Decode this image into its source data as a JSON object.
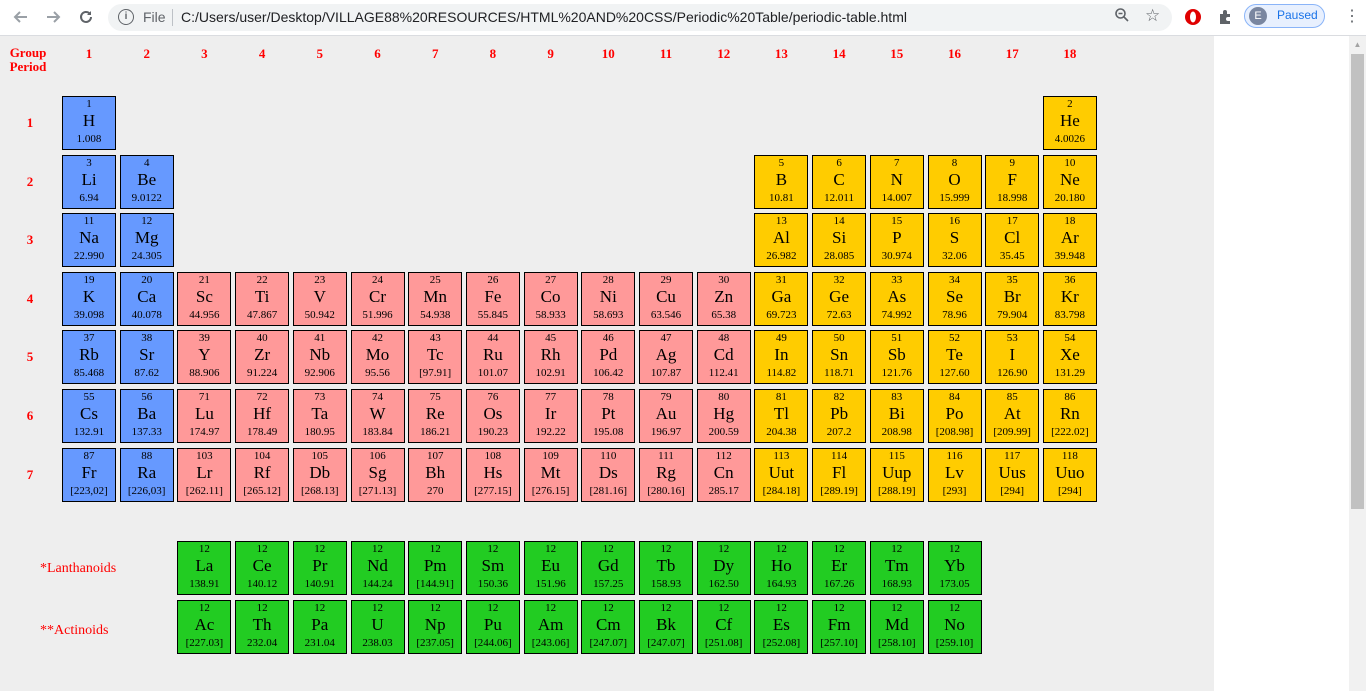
{
  "browser": {
    "back_icon": "arrow-left-icon",
    "forward_icon": "arrow-right-icon",
    "reload_icon": "reload-icon",
    "scheme_label": "File",
    "url": "C:/Users/user/Desktop/VILLAGE88%20RESOURCES/HTML%20AND%20CSS/Periodic%20Table/periodic-table.html",
    "profile_initial": "E",
    "profile_status": "Paused"
  },
  "table": {
    "group_label": "Group",
    "period_label": "Period",
    "groups": [
      "1",
      "2",
      "3",
      "4",
      "5",
      "6",
      "7",
      "8",
      "9",
      "10",
      "11",
      "12",
      "13",
      "14",
      "15",
      "16",
      "17",
      "18"
    ],
    "periods": [
      "1",
      "2",
      "3",
      "4",
      "5",
      "6",
      "7"
    ],
    "lanthanoids_label": "*Lanthanoids",
    "actinoids_label": "**Actinoids",
    "colors": {
      "blue": "#6699ff",
      "red": "#ff9999",
      "orange": "#ffcc00",
      "green": "#22cc22",
      "labels": "#ff0000",
      "background": "#eeeeee"
    },
    "elements": [
      {
        "n": "1",
        "s": "H",
        "m": "1.008",
        "g": 1,
        "p": 1,
        "c": "blue"
      },
      {
        "n": "2",
        "s": "He",
        "m": "4.0026",
        "g": 18,
        "p": 1,
        "c": "orange"
      },
      {
        "n": "3",
        "s": "Li",
        "m": "6.94",
        "g": 1,
        "p": 2,
        "c": "blue"
      },
      {
        "n": "4",
        "s": "Be",
        "m": "9.0122",
        "g": 2,
        "p": 2,
        "c": "blue"
      },
      {
        "n": "5",
        "s": "B",
        "m": "10.81",
        "g": 13,
        "p": 2,
        "c": "orange"
      },
      {
        "n": "6",
        "s": "C",
        "m": "12.011",
        "g": 14,
        "p": 2,
        "c": "orange"
      },
      {
        "n": "7",
        "s": "N",
        "m": "14.007",
        "g": 15,
        "p": 2,
        "c": "orange"
      },
      {
        "n": "8",
        "s": "O",
        "m": "15.999",
        "g": 16,
        "p": 2,
        "c": "orange"
      },
      {
        "n": "9",
        "s": "F",
        "m": "18.998",
        "g": 17,
        "p": 2,
        "c": "orange"
      },
      {
        "n": "10",
        "s": "Ne",
        "m": "20.180",
        "g": 18,
        "p": 2,
        "c": "orange"
      },
      {
        "n": "11",
        "s": "Na",
        "m": "22.990",
        "g": 1,
        "p": 3,
        "c": "blue"
      },
      {
        "n": "12",
        "s": "Mg",
        "m": "24.305",
        "g": 2,
        "p": 3,
        "c": "blue"
      },
      {
        "n": "13",
        "s": "Al",
        "m": "26.982",
        "g": 13,
        "p": 3,
        "c": "orange"
      },
      {
        "n": "14",
        "s": "Si",
        "m": "28.085",
        "g": 14,
        "p": 3,
        "c": "orange"
      },
      {
        "n": "15",
        "s": "P",
        "m": "30.974",
        "g": 15,
        "p": 3,
        "c": "orange"
      },
      {
        "n": "16",
        "s": "S",
        "m": "32.06",
        "g": 16,
        "p": 3,
        "c": "orange"
      },
      {
        "n": "17",
        "s": "Cl",
        "m": "35.45",
        "g": 17,
        "p": 3,
        "c": "orange"
      },
      {
        "n": "18",
        "s": "Ar",
        "m": "39.948",
        "g": 18,
        "p": 3,
        "c": "orange"
      },
      {
        "n": "19",
        "s": "K",
        "m": "39.098",
        "g": 1,
        "p": 4,
        "c": "blue"
      },
      {
        "n": "20",
        "s": "Ca",
        "m": "40.078",
        "g": 2,
        "p": 4,
        "c": "blue"
      },
      {
        "n": "21",
        "s": "Sc",
        "m": "44.956",
        "g": 3,
        "p": 4,
        "c": "red"
      },
      {
        "n": "22",
        "s": "Ti",
        "m": "47.867",
        "g": 4,
        "p": 4,
        "c": "red"
      },
      {
        "n": "23",
        "s": "V",
        "m": "50.942",
        "g": 5,
        "p": 4,
        "c": "red"
      },
      {
        "n": "24",
        "s": "Cr",
        "m": "51.996",
        "g": 6,
        "p": 4,
        "c": "red"
      },
      {
        "n": "25",
        "s": "Mn",
        "m": "54.938",
        "g": 7,
        "p": 4,
        "c": "red"
      },
      {
        "n": "26",
        "s": "Fe",
        "m": "55.845",
        "g": 8,
        "p": 4,
        "c": "red"
      },
      {
        "n": "27",
        "s": "Co",
        "m": "58.933",
        "g": 9,
        "p": 4,
        "c": "red"
      },
      {
        "n": "28",
        "s": "Ni",
        "m": "58.693",
        "g": 10,
        "p": 4,
        "c": "red"
      },
      {
        "n": "29",
        "s": "Cu",
        "m": "63.546",
        "g": 11,
        "p": 4,
        "c": "red"
      },
      {
        "n": "30",
        "s": "Zn",
        "m": "65.38",
        "g": 12,
        "p": 4,
        "c": "red"
      },
      {
        "n": "31",
        "s": "Ga",
        "m": "69.723",
        "g": 13,
        "p": 4,
        "c": "orange"
      },
      {
        "n": "32",
        "s": "Ge",
        "m": "72.63",
        "g": 14,
        "p": 4,
        "c": "orange"
      },
      {
        "n": "33",
        "s": "As",
        "m": "74.992",
        "g": 15,
        "p": 4,
        "c": "orange"
      },
      {
        "n": "34",
        "s": "Se",
        "m": "78.96",
        "g": 16,
        "p": 4,
        "c": "orange"
      },
      {
        "n": "35",
        "s": "Br",
        "m": "79.904",
        "g": 17,
        "p": 4,
        "c": "orange"
      },
      {
        "n": "36",
        "s": "Kr",
        "m": "83.798",
        "g": 18,
        "p": 4,
        "c": "orange"
      },
      {
        "n": "37",
        "s": "Rb",
        "m": "85.468",
        "g": 1,
        "p": 5,
        "c": "blue"
      },
      {
        "n": "38",
        "s": "Sr",
        "m": "87.62",
        "g": 2,
        "p": 5,
        "c": "blue"
      },
      {
        "n": "39",
        "s": "Y",
        "m": "88.906",
        "g": 3,
        "p": 5,
        "c": "red"
      },
      {
        "n": "40",
        "s": "Zr",
        "m": "91.224",
        "g": 4,
        "p": 5,
        "c": "red"
      },
      {
        "n": "41",
        "s": "Nb",
        "m": "92.906",
        "g": 5,
        "p": 5,
        "c": "red"
      },
      {
        "n": "42",
        "s": "Mo",
        "m": "95.56",
        "g": 6,
        "p": 5,
        "c": "red"
      },
      {
        "n": "43",
        "s": "Tc",
        "m": "[97.91]",
        "g": 7,
        "p": 5,
        "c": "red"
      },
      {
        "n": "44",
        "s": "Ru",
        "m": "101.07",
        "g": 8,
        "p": 5,
        "c": "red"
      },
      {
        "n": "45",
        "s": "Rh",
        "m": "102.91",
        "g": 9,
        "p": 5,
        "c": "red"
      },
      {
        "n": "46",
        "s": "Pd",
        "m": "106.42",
        "g": 10,
        "p": 5,
        "c": "red"
      },
      {
        "n": "47",
        "s": "Ag",
        "m": "107.87",
        "g": 11,
        "p": 5,
        "c": "red"
      },
      {
        "n": "48",
        "s": "Cd",
        "m": "112.41",
        "g": 12,
        "p": 5,
        "c": "red"
      },
      {
        "n": "49",
        "s": "In",
        "m": "114.82",
        "g": 13,
        "p": 5,
        "c": "orange"
      },
      {
        "n": "50",
        "s": "Sn",
        "m": "118.71",
        "g": 14,
        "p": 5,
        "c": "orange"
      },
      {
        "n": "51",
        "s": "Sb",
        "m": "121.76",
        "g": 15,
        "p": 5,
        "c": "orange"
      },
      {
        "n": "52",
        "s": "Te",
        "m": "127.60",
        "g": 16,
        "p": 5,
        "c": "orange"
      },
      {
        "n": "53",
        "s": "I",
        "m": "126.90",
        "g": 17,
        "p": 5,
        "c": "orange"
      },
      {
        "n": "54",
        "s": "Xe",
        "m": "131.29",
        "g": 18,
        "p": 5,
        "c": "orange"
      },
      {
        "n": "55",
        "s": "Cs",
        "m": "132.91",
        "g": 1,
        "p": 6,
        "c": "blue"
      },
      {
        "n": "56",
        "s": "Ba",
        "m": "137.33",
        "g": 2,
        "p": 6,
        "c": "blue"
      },
      {
        "n": "71",
        "s": "Lu",
        "m": "174.97",
        "g": 3,
        "p": 6,
        "c": "red"
      },
      {
        "n": "72",
        "s": "Hf",
        "m": "178.49",
        "g": 4,
        "p": 6,
        "c": "red"
      },
      {
        "n": "73",
        "s": "Ta",
        "m": "180.95",
        "g": 5,
        "p": 6,
        "c": "red"
      },
      {
        "n": "74",
        "s": "W",
        "m": "183.84",
        "g": 6,
        "p": 6,
        "c": "red"
      },
      {
        "n": "75",
        "s": "Re",
        "m": "186.21",
        "g": 7,
        "p": 6,
        "c": "red"
      },
      {
        "n": "76",
        "s": "Os",
        "m": "190.23",
        "g": 8,
        "p": 6,
        "c": "red"
      },
      {
        "n": "77",
        "s": "Ir",
        "m": "192.22",
        "g": 9,
        "p": 6,
        "c": "red"
      },
      {
        "n": "78",
        "s": "Pt",
        "m": "195.08",
        "g": 10,
        "p": 6,
        "c": "red"
      },
      {
        "n": "79",
        "s": "Au",
        "m": "196.97",
        "g": 11,
        "p": 6,
        "c": "red"
      },
      {
        "n": "80",
        "s": "Hg",
        "m": "200.59",
        "g": 12,
        "p": 6,
        "c": "red"
      },
      {
        "n": "81",
        "s": "Tl",
        "m": "204.38",
        "g": 13,
        "p": 6,
        "c": "orange"
      },
      {
        "n": "82",
        "s": "Pb",
        "m": "207.2",
        "g": 14,
        "p": 6,
        "c": "orange"
      },
      {
        "n": "83",
        "s": "Bi",
        "m": "208.98",
        "g": 15,
        "p": 6,
        "c": "orange"
      },
      {
        "n": "84",
        "s": "Po",
        "m": "[208.98]",
        "g": 16,
        "p": 6,
        "c": "orange"
      },
      {
        "n": "85",
        "s": "At",
        "m": "[209.99]",
        "g": 17,
        "p": 6,
        "c": "orange"
      },
      {
        "n": "86",
        "s": "Rn",
        "m": "[222.02]",
        "g": 18,
        "p": 6,
        "c": "orange"
      },
      {
        "n": "87",
        "s": "Fr",
        "m": "[223,02]",
        "g": 1,
        "p": 7,
        "c": "blue"
      },
      {
        "n": "88",
        "s": "Ra",
        "m": "[226,03]",
        "g": 2,
        "p": 7,
        "c": "blue"
      },
      {
        "n": "103",
        "s": "Lr",
        "m": "[262.11]",
        "g": 3,
        "p": 7,
        "c": "red"
      },
      {
        "n": "104",
        "s": "Rf",
        "m": "[265.12]",
        "g": 4,
        "p": 7,
        "c": "red"
      },
      {
        "n": "105",
        "s": "Db",
        "m": "[268.13]",
        "g": 5,
        "p": 7,
        "c": "red"
      },
      {
        "n": "106",
        "s": "Sg",
        "m": "[271.13]",
        "g": 6,
        "p": 7,
        "c": "red"
      },
      {
        "n": "107",
        "s": "Bh",
        "m": "270",
        "g": 7,
        "p": 7,
        "c": "red"
      },
      {
        "n": "108",
        "s": "Hs",
        "m": "[277.15]",
        "g": 8,
        "p": 7,
        "c": "red"
      },
      {
        "n": "109",
        "s": "Mt",
        "m": "[276.15]",
        "g": 9,
        "p": 7,
        "c": "red"
      },
      {
        "n": "110",
        "s": "Ds",
        "m": "[281.16]",
        "g": 10,
        "p": 7,
        "c": "red"
      },
      {
        "n": "111",
        "s": "Rg",
        "m": "[280.16]",
        "g": 11,
        "p": 7,
        "c": "red"
      },
      {
        "n": "112",
        "s": "Cn",
        "m": "285.17",
        "g": 12,
        "p": 7,
        "c": "red"
      },
      {
        "n": "113",
        "s": "Uut",
        "m": "[284.18]",
        "g": 13,
        "p": 7,
        "c": "orange"
      },
      {
        "n": "114",
        "s": "Fl",
        "m": "[289.19]",
        "g": 14,
        "p": 7,
        "c": "orange"
      },
      {
        "n": "115",
        "s": "Uup",
        "m": "[288.19]",
        "g": 15,
        "p": 7,
        "c": "orange"
      },
      {
        "n": "116",
        "s": "Lv",
        "m": "[293]",
        "g": 16,
        "p": 7,
        "c": "orange"
      },
      {
        "n": "117",
        "s": "Uus",
        "m": "[294]",
        "g": 17,
        "p": 7,
        "c": "orange"
      },
      {
        "n": "118",
        "s": "Uuo",
        "m": "[294]",
        "g": 18,
        "p": 7,
        "c": "orange"
      }
    ],
    "lanthanoids": [
      {
        "n": "12",
        "s": "La",
        "m": "138.91"
      },
      {
        "n": "12",
        "s": "Ce",
        "m": "140.12"
      },
      {
        "n": "12",
        "s": "Pr",
        "m": "140.91"
      },
      {
        "n": "12",
        "s": "Nd",
        "m": "144.24"
      },
      {
        "n": "12",
        "s": "Pm",
        "m": "[144.91]"
      },
      {
        "n": "12",
        "s": "Sm",
        "m": "150.36"
      },
      {
        "n": "12",
        "s": "Eu",
        "m": "151.96"
      },
      {
        "n": "12",
        "s": "Gd",
        "m": "157.25"
      },
      {
        "n": "12",
        "s": "Tb",
        "m": "158.93"
      },
      {
        "n": "12",
        "s": "Dy",
        "m": "162.50"
      },
      {
        "n": "12",
        "s": "Ho",
        "m": "164.93"
      },
      {
        "n": "12",
        "s": "Er",
        "m": "167.26"
      },
      {
        "n": "12",
        "s": "Tm",
        "m": "168.93"
      },
      {
        "n": "12",
        "s": "Yb",
        "m": "173.05"
      }
    ],
    "actinoids": [
      {
        "n": "12",
        "s": "Ac",
        "m": "[227.03]"
      },
      {
        "n": "12",
        "s": "Th",
        "m": "232.04"
      },
      {
        "n": "12",
        "s": "Pa",
        "m": "231.04"
      },
      {
        "n": "12",
        "s": "U",
        "m": "238.03"
      },
      {
        "n": "12",
        "s": "Np",
        "m": "[237.05]"
      },
      {
        "n": "12",
        "s": "Pu",
        "m": "[244.06]"
      },
      {
        "n": "12",
        "s": "Am",
        "m": "[243.06]"
      },
      {
        "n": "12",
        "s": "Cm",
        "m": "[247.07]"
      },
      {
        "n": "12",
        "s": "Bk",
        "m": "[247.07]"
      },
      {
        "n": "12",
        "s": "Cf",
        "m": "[251.08]"
      },
      {
        "n": "12",
        "s": "Es",
        "m": "[252.08]"
      },
      {
        "n": "12",
        "s": "Fm",
        "m": "[257.10]"
      },
      {
        "n": "12",
        "s": "Md",
        "m": "[258.10]"
      },
      {
        "n": "12",
        "s": "No",
        "m": "[259.10]"
      }
    ]
  }
}
